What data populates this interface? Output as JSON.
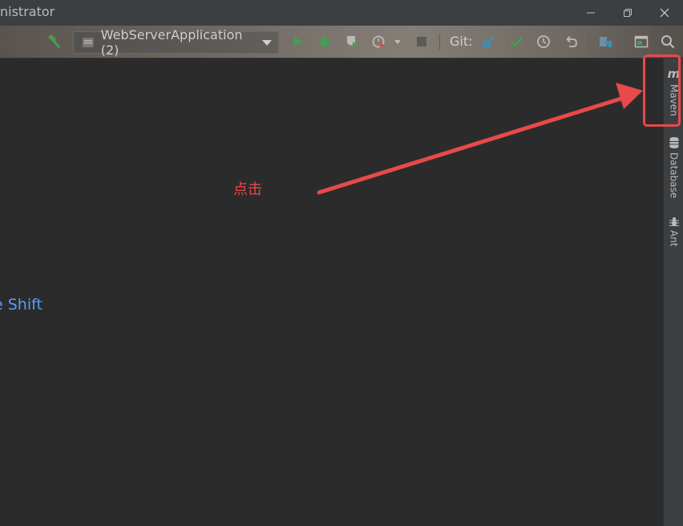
{
  "window": {
    "title": "nistrator"
  },
  "toolbar": {
    "run_config_label": "WebServerApplication (2)",
    "git_label": "Git:"
  },
  "editor": {
    "hint_text": "e Shift"
  },
  "right_strip": {
    "tabs": [
      {
        "label": "Maven",
        "icon": "maven-m-icon"
      },
      {
        "label": "Database",
        "icon": "database-icon"
      },
      {
        "label": "Ant",
        "icon": "ant-icon"
      }
    ],
    "maven_glyph": "m"
  },
  "annotation": {
    "text": "点击",
    "color": "#e8494a"
  },
  "colors": {
    "run_green": "#499c54",
    "git_blue": "#3592c4",
    "link_blue": "#589df6"
  }
}
